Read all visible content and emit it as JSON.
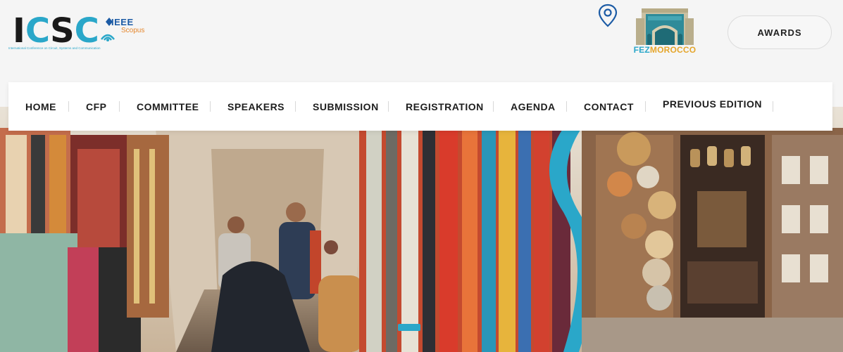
{
  "logo": {
    "letters": [
      "I",
      "C",
      "S",
      "C"
    ],
    "ieee": "IEEE",
    "scopus": "Scopus",
    "tagline": "International Conference on Circuit, Systems and Communication"
  },
  "location": {
    "pin_icon": "location-pin-icon"
  },
  "fez_logo": {
    "fez": "FEZ",
    "morocco": "MOROCCO"
  },
  "header": {
    "awards_label": "AWARDS"
  },
  "nav": {
    "items": [
      {
        "label": "HOME"
      },
      {
        "label": "CFP"
      },
      {
        "label": "COMMITTEE"
      },
      {
        "label": "SPEAKERS"
      },
      {
        "label": "SUBMISSION"
      },
      {
        "label": "REGISTRATION"
      },
      {
        "label": "AGENDA"
      },
      {
        "label": "CONTACT"
      },
      {
        "label": "PREVIOUS EDITION"
      }
    ]
  },
  "colors": {
    "accent": "#2aa7c9",
    "brand_dark": "#1a1a1a",
    "gold": "#e5a62c",
    "ieee_blue": "#1c5ba5"
  }
}
